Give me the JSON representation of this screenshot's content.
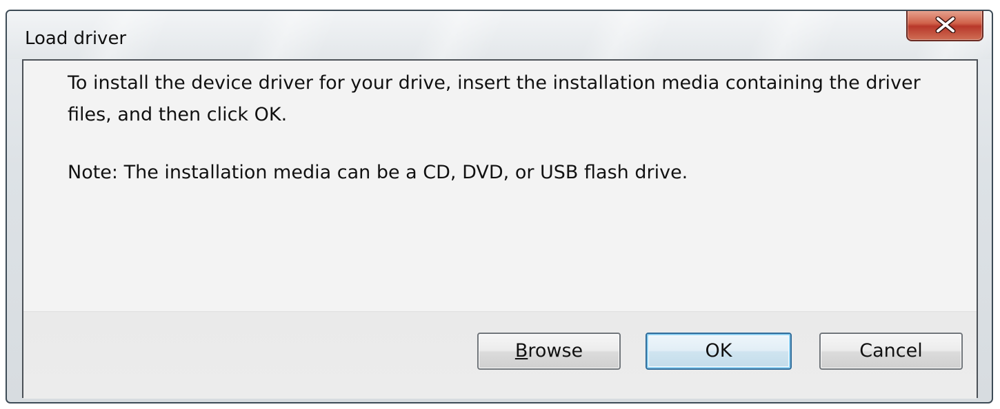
{
  "window": {
    "title": "Load driver",
    "close_glyph": "X"
  },
  "message": {
    "instruction": "To install the device driver for your drive, insert the installation media containing the driver files, and then click OK.",
    "note": "Note: The installation media can be a CD, DVD, or USB flash drive."
  },
  "buttons": {
    "browse_accel": "B",
    "browse_rest": "rowse",
    "ok": "OK",
    "cancel": "Cancel"
  },
  "icons": {
    "close": "close-icon"
  },
  "colors": {
    "close_button": "#c8503c",
    "default_button_border": "#2f6c9a"
  }
}
